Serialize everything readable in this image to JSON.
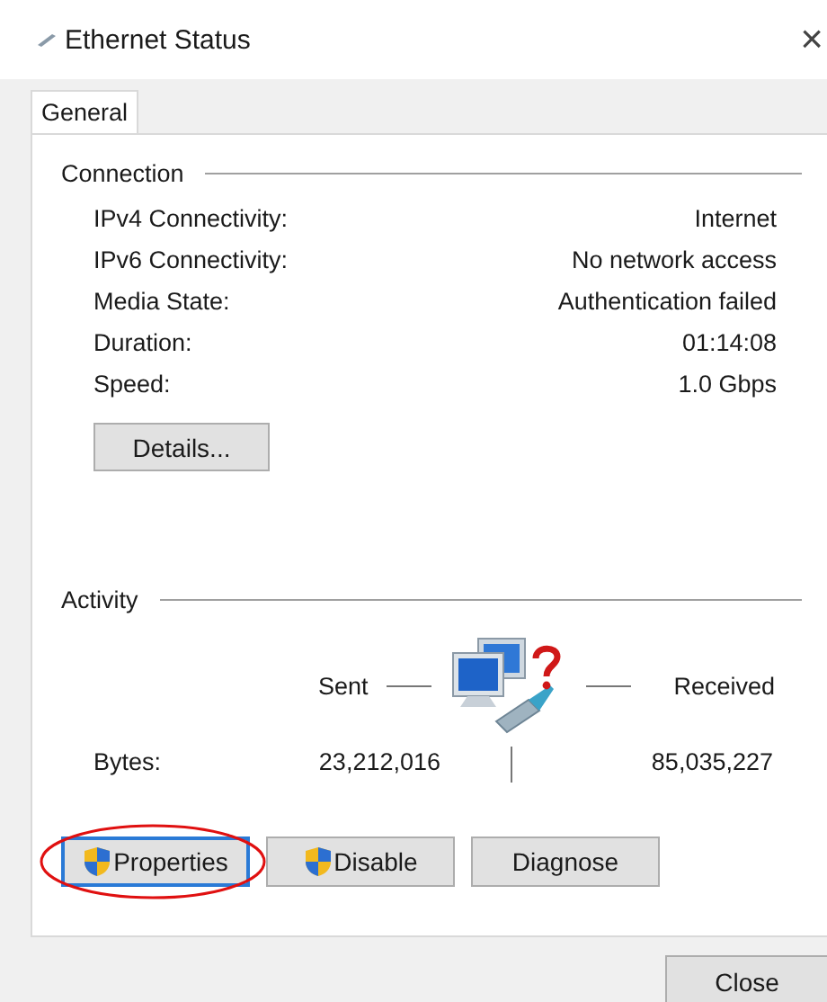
{
  "window": {
    "title": "Ethernet Status",
    "close": "×"
  },
  "tabs": [
    {
      "label": "General",
      "selected": true
    }
  ],
  "connection": {
    "heading": "Connection",
    "rows": [
      {
        "label": "IPv4 Connectivity:",
        "value": "Internet"
      },
      {
        "label": "IPv6 Connectivity:",
        "value": "No network access"
      },
      {
        "label": "Media State:",
        "value": "Authentication failed"
      },
      {
        "label": "Duration:",
        "value": "01:14:08"
      },
      {
        "label": "Speed:",
        "value": "1.0 Gbps"
      }
    ],
    "details_button": "Details..."
  },
  "activity": {
    "heading": "Activity",
    "sent_label": "Sent",
    "received_label": "Received",
    "bytes_label": "Bytes:",
    "bytes_sent": "23,212,016",
    "bytes_received": "85,035,227"
  },
  "buttons": [
    {
      "label": "Properties",
      "shield": true,
      "focused": true,
      "circled": true
    },
    {
      "label": "Disable",
      "shield": true,
      "focused": false,
      "circled": false
    },
    {
      "label": "Diagnose",
      "shield": false,
      "focused": false,
      "circled": false
    }
  ],
  "footer_button": "Close"
}
